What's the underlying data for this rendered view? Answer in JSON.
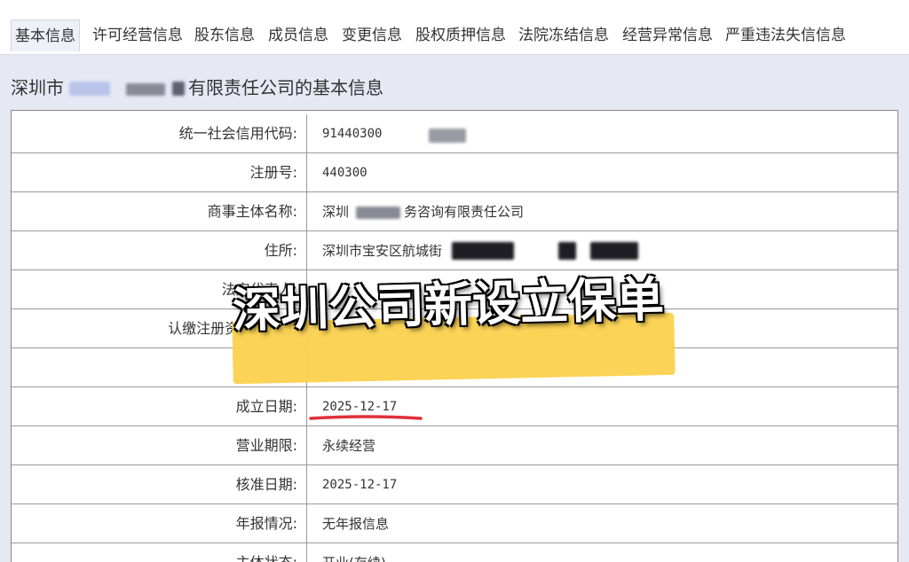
{
  "tabs": [
    {
      "label": "基本信息",
      "active": true
    },
    {
      "label": "许可经营信息"
    },
    {
      "label": "股东信息"
    },
    {
      "label": "成员信息"
    },
    {
      "label": "变更信息"
    },
    {
      "label": "股权质押信息"
    },
    {
      "label": "法院冻结信息"
    },
    {
      "label": "经营异常信息"
    },
    {
      "label": "严重违法失信信息"
    }
  ],
  "title": {
    "prefix": "深圳市",
    "suffix": "有限责任公司的基本信息"
  },
  "rows": [
    {
      "label": "统一社会信用代码:",
      "value": "91440300"
    },
    {
      "label": "注册号:",
      "value": "440300"
    },
    {
      "label": "商事主体名称:",
      "value_prefix": "深圳",
      "value_suffix": "务咨询有限责任公司"
    },
    {
      "label": "住所:",
      "value": "深圳市宝安区航城街"
    },
    {
      "label": "法定代表人:",
      "value": ""
    },
    {
      "label": "认缴注册资本(万元):",
      "value": ""
    },
    {
      "label": "",
      "value": ""
    },
    {
      "label": "成立日期:",
      "value": "2025-12-17"
    },
    {
      "label": "营业期限:",
      "value": "永续经营"
    },
    {
      "label": "核准日期:",
      "value": "2025-12-17"
    },
    {
      "label": "年报情况:",
      "value": "无年报信息"
    },
    {
      "label": "主体状态:",
      "value": "开业(存续)"
    }
  ],
  "overlay": {
    "caption": "深圳公司新设立保单",
    "highlight_color": "#fbd24e",
    "underline_color": "#e0303a"
  }
}
